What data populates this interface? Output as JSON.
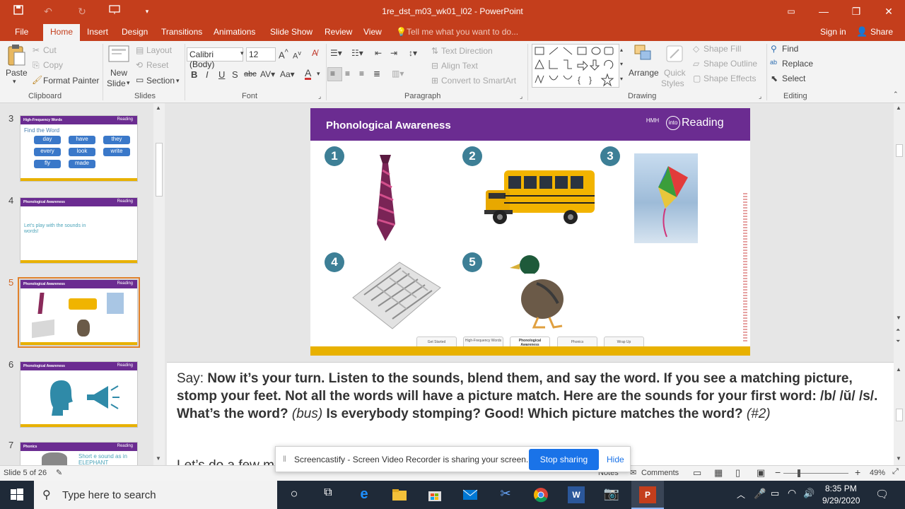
{
  "window": {
    "title": "1re_dst_m03_wk01_l02 - PowerPoint",
    "restore_icon": "restore-icon",
    "minimize_icon": "minimize-icon",
    "maximize_icon": "maximize-icon",
    "close_icon": "close-icon"
  },
  "quick_access": {
    "save": "save-icon",
    "undo": "undo-icon",
    "redo": "redo-icon",
    "present": "present-icon",
    "customize": "customize-icon"
  },
  "tabs": [
    "File",
    "Home",
    "Insert",
    "Design",
    "Transitions",
    "Animations",
    "Slide Show",
    "Review",
    "View"
  ],
  "tell_me": "Tell me what you want to do...",
  "account": {
    "signin": "Sign in",
    "share": "Share"
  },
  "ribbon": {
    "clipboard": {
      "paste": "Paste",
      "cut": "Cut",
      "copy": "Copy",
      "format_painter": "Format Painter",
      "group": "Clipboard"
    },
    "slides": {
      "new_slide_1": "New",
      "new_slide_2": "Slide",
      "layout": "Layout",
      "reset": "Reset",
      "section": "Section",
      "group": "Slides"
    },
    "font": {
      "name": "Calibri (Body)",
      "size": "12",
      "group": "Font"
    },
    "paragraph": {
      "text_direction": "Text Direction",
      "align_text": "Align Text",
      "convert": "Convert to SmartArt",
      "group": "Paragraph"
    },
    "drawing": {
      "arrange": "Arrange",
      "quick_styles_1": "Quick",
      "quick_styles_2": "Styles",
      "shape_fill": "Shape Fill",
      "shape_outline": "Shape Outline",
      "shape_effects": "Shape Effects",
      "group": "Drawing"
    },
    "editing": {
      "find": "Find",
      "replace": "Replace",
      "select": "Select",
      "group": "Editing"
    }
  },
  "thumbnails": [
    {
      "num": "3",
      "header": "High-Frequency Words",
      "title": "Find the Word",
      "words": [
        "day",
        "have",
        "they",
        "every",
        "look",
        "write",
        "fly",
        "made"
      ]
    },
    {
      "num": "4",
      "header": "Phonological Awareness",
      "text": "Let's play with the sounds in words!"
    },
    {
      "num": "5",
      "header": "Phonological Awareness"
    },
    {
      "num": "6",
      "header": "Phonological Awareness"
    },
    {
      "num": "7",
      "header": "Phonics",
      "text": "Short e sound as in ELEPHANT"
    }
  ],
  "thumb_brand": "Reading",
  "slide": {
    "title": "Phonological Awareness",
    "brand_logo": "HMH",
    "brand_into": "into",
    "brand_reading": "Reading",
    "numbers": [
      "1",
      "2",
      "3",
      "4",
      "5"
    ],
    "pictures": [
      "tie",
      "bus",
      "kite",
      "maze",
      "duck"
    ],
    "nav": [
      "Get Started",
      "High-Frequency Words",
      "Phonological Awareness",
      "Phonics",
      "Wrap Up"
    ],
    "accent": "#6b2c91",
    "footer_color": "#e8b100"
  },
  "notes": {
    "say": "Say:",
    "bold1": "Now it’s your turn. Listen to the sounds, blend them, and say the word. If you see a matching picture, stomp your feet. Not all the words will have a picture match. Here are the sounds for your first word: /b/ /ŭ/ /s/. What’s the word?",
    "ital1": "(bus)",
    "bold2": "Is everybody stomping? Good! Which picture matches the word?",
    "ital2": "(#2)",
    "next": "Let’s do a few m"
  },
  "status": {
    "slide": "Slide 5 of 26",
    "notes": "Notes",
    "comments": "Comments",
    "zoom": "49%"
  },
  "screencastify": {
    "message": "Screencastify - Screen Video Recorder is sharing your screen.",
    "stop": "Stop sharing",
    "hide": "Hide"
  },
  "taskbar": {
    "search": "Type here to search",
    "time": "8:35 PM",
    "date": "9/29/2020"
  }
}
